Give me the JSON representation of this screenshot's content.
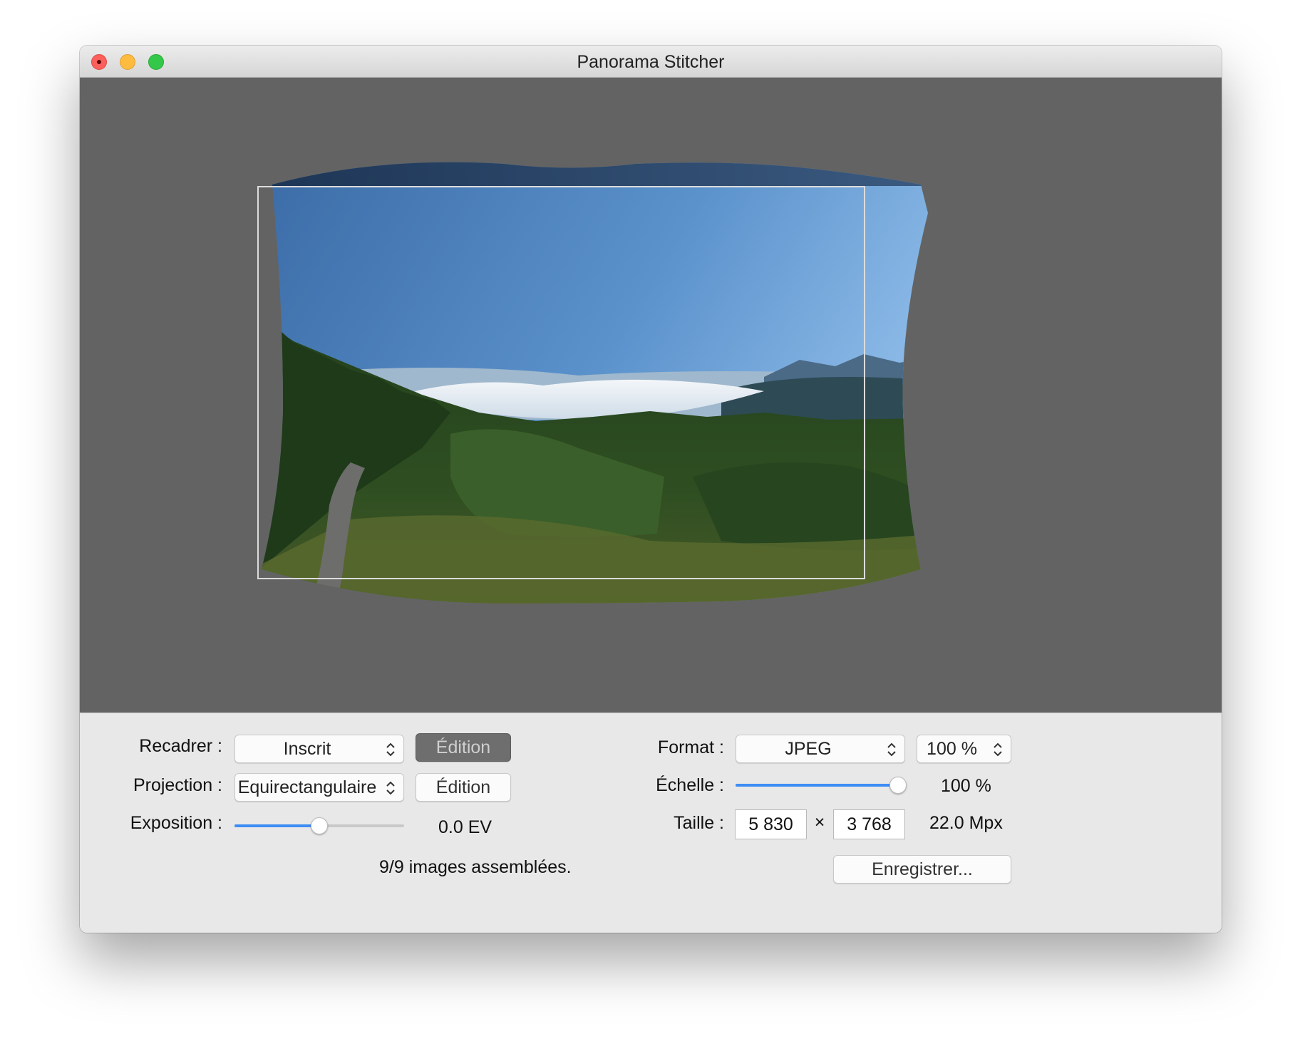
{
  "window": {
    "title": "Panorama Stitcher"
  },
  "crop": {
    "label": "Recadrer :",
    "value": "Inscrit",
    "edit_label": "Édition"
  },
  "projection": {
    "label": "Projection :",
    "value": "Equirectangulaire",
    "edit_label": "Édition"
  },
  "exposure": {
    "label": "Exposition :",
    "value": "0.0 EV",
    "level": 0.5
  },
  "status": {
    "text": "9/9 images assemblées."
  },
  "format": {
    "label": "Format :",
    "value": "JPEG",
    "quality": "100 %"
  },
  "scale": {
    "label": "Échelle :",
    "value": "100 %",
    "level": 1.0
  },
  "size": {
    "label": "Taille :",
    "width": "5 830",
    "times": "×",
    "height": "3 768",
    "megapixels": "22.0 Mpx"
  },
  "save": {
    "label": "Enregistrer..."
  },
  "icons": {
    "close": "close-icon",
    "minimize": "minimize-icon",
    "zoom": "zoom-icon",
    "stepper": "chevron-up-down-icon"
  },
  "colors": {
    "accent": "#3d8df5",
    "canvas_bg": "#636363",
    "panel_bg": "#e8e8e8"
  }
}
